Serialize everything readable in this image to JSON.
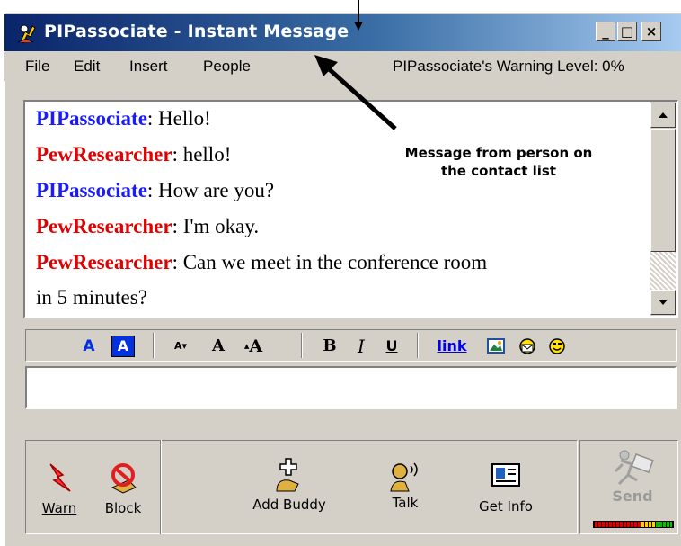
{
  "window": {
    "title": "PIPassociate - Instant Message",
    "controls": {
      "minimize": "_",
      "maximize": "□",
      "close": "×"
    }
  },
  "menubar": {
    "items": [
      {
        "label": "File"
      },
      {
        "label": "Edit"
      },
      {
        "label": "Insert"
      },
      {
        "label": "People"
      }
    ],
    "warning_level": "PIPassociate's Warning Level: 0%"
  },
  "colors": {
    "self_name": "#1a1aff",
    "other_name": "#e00000",
    "titlebar_start": "#0a246a",
    "titlebar_end": "#a6caf0"
  },
  "conversation": {
    "messages": [
      {
        "sender": "PIPassociate",
        "role": "self",
        "text": ": Hello!"
      },
      {
        "sender": "PewResearcher",
        "role": "other",
        "text": ": hello!"
      },
      {
        "sender": "PIPassociate",
        "role": "self",
        "text": ": How are you?"
      },
      {
        "sender": "PewResearcher",
        "role": "other",
        "text": ": I'm okay."
      },
      {
        "sender": "PewResearcher",
        "role": "other",
        "text": ": Can we meet in the conference room"
      }
    ],
    "wrapped_line": "in 5 minutes?"
  },
  "annotation": {
    "line1": "Message from person on",
    "line2": "the contact list"
  },
  "format_toolbar": {
    "text_color": "A",
    "background_color": "A",
    "decrease_font": "A",
    "normal_font": "A",
    "increase_font": "A",
    "bold": "B",
    "italic": "I",
    "underline": "U",
    "link": "link"
  },
  "message_input": {
    "value": ""
  },
  "actions": {
    "warn": "Warn",
    "block": "Block",
    "add_buddy": "Add Buddy",
    "talk": "Talk",
    "get_info": "Get Info",
    "send": "Send"
  }
}
